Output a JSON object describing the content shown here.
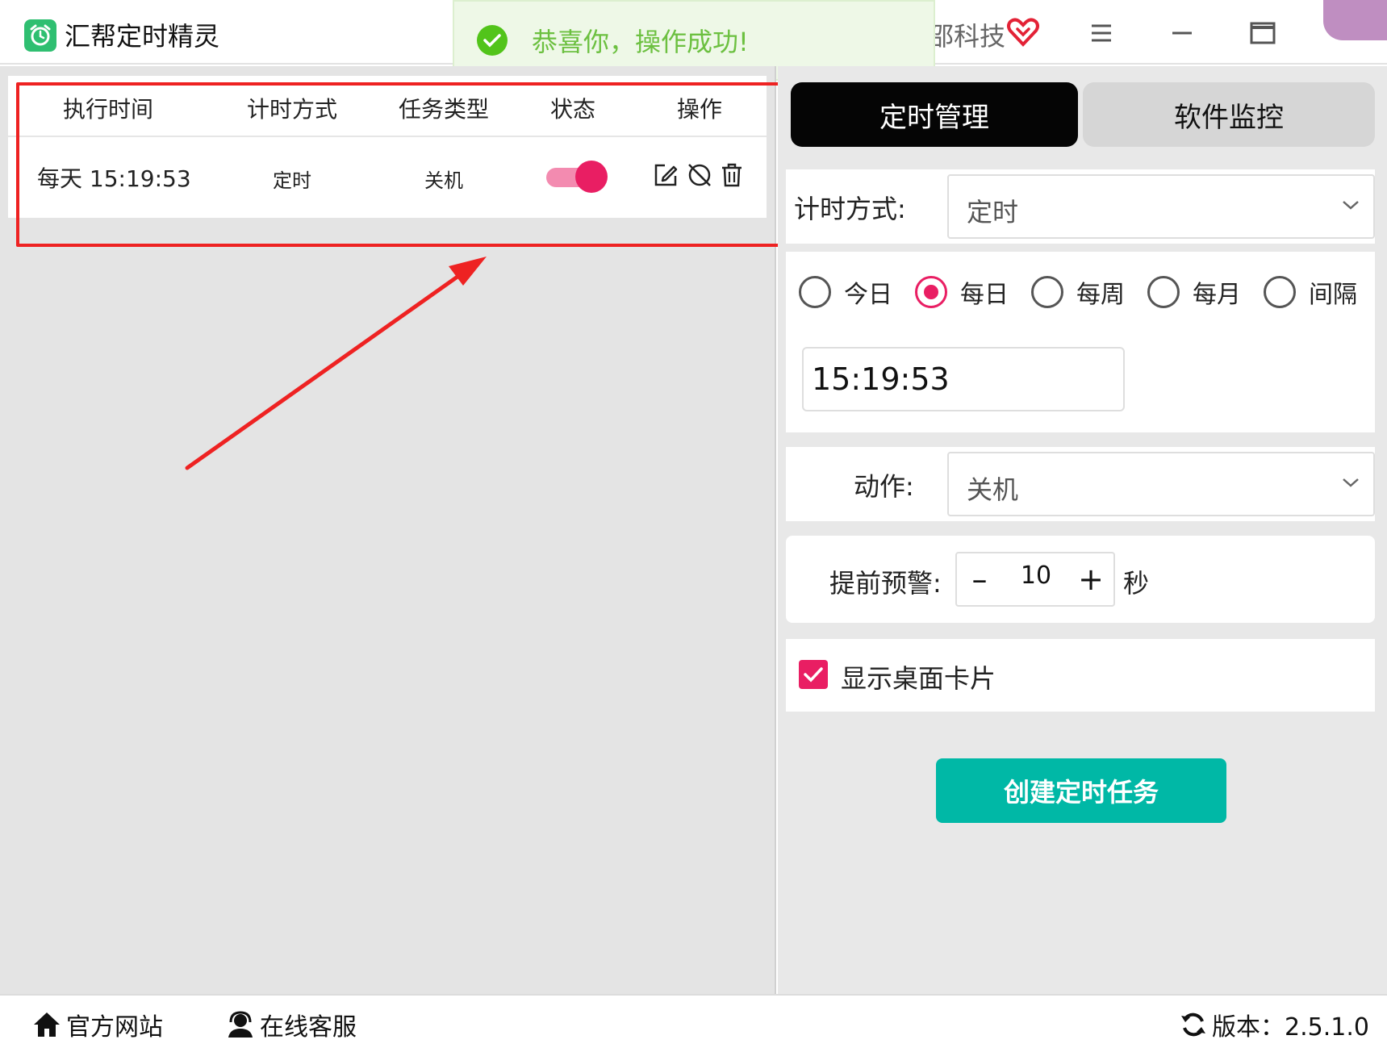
{
  "app": {
    "title": "汇帮定时精灵",
    "brand_partial": "邵科技",
    "accent_color": "#e91e63",
    "primary_color": "#00b8a6"
  },
  "toast": {
    "message": "恭喜你，操作成功!",
    "icon": "check-circle-icon",
    "color": "#52c41a"
  },
  "task_table": {
    "headers": [
      "执行时间",
      "计时方式",
      "任务类型",
      "状态",
      "操作"
    ],
    "rows": [
      {
        "time": "每天 15:19:53",
        "timing_mode": "定时",
        "task_type": "关机",
        "enabled": true,
        "actions": [
          "edit-icon",
          "pause-icon",
          "delete-icon"
        ]
      }
    ]
  },
  "tabs": [
    {
      "label": "定时管理",
      "active": true
    },
    {
      "label": "软件监控",
      "active": false
    }
  ],
  "form": {
    "timing_label": "计时方式:",
    "timing_value": "定时",
    "frequency_options": [
      {
        "label": "今日",
        "checked": false
      },
      {
        "label": "每日",
        "checked": true
      },
      {
        "label": "每周",
        "checked": false
      },
      {
        "label": "每月",
        "checked": false
      },
      {
        "label": "间隔",
        "checked": false
      }
    ],
    "time_value": "15:19:53",
    "action_label": "动作:",
    "action_value": "关机",
    "warning_label": "提前预警:",
    "warning_value": "10",
    "warning_minus": "–",
    "warning_plus": "+",
    "warning_unit": "秒",
    "show_card_label": "显示桌面卡片",
    "show_card_checked": true,
    "create_button": "创建定时任务"
  },
  "footer": {
    "website": "官方网站",
    "support": "在线客服",
    "version": "版本：2.5.1.0"
  }
}
